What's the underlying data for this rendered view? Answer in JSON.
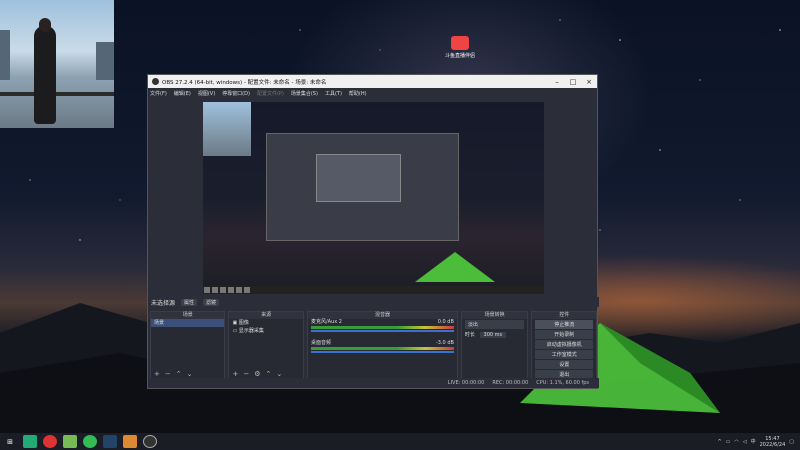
{
  "desktop": {
    "icon_label": "斗鱼直播伴侣"
  },
  "obs": {
    "title": "OBS 27.2.4 (64-bit, windows) - 配置文件: 未命名 - 场景: 未命名",
    "menu": [
      "文件(F)",
      "编辑(E)",
      "视图(V)",
      "停靠窗口(D)",
      "配置文件(P)",
      "场景集合(S)",
      "工具(T)",
      "帮助(H)"
    ],
    "strip": {
      "label": "未选择源",
      "btn1": "属性",
      "btn2": "滤镜"
    },
    "scenes": {
      "header": "场景",
      "items": [
        "场景"
      ]
    },
    "sources": {
      "header": "来源",
      "items": [
        "图像",
        "显示器采集"
      ]
    },
    "mixer": {
      "header": "混音器",
      "ch1": {
        "name": "麦克风/Aux 2",
        "db": "0.0 dB"
      },
      "ch2": {
        "name": "桌面音频",
        "db": "-3.0 dB"
      }
    },
    "transitions": {
      "header": "场景转换",
      "type": "淡出",
      "duration_label": "时长",
      "duration": "300 ms"
    },
    "controls": {
      "header": "控件",
      "buttons": [
        "停止推流",
        "开始录制",
        "启动虚拟摄像机",
        "工作室模式",
        "设置",
        "退出"
      ]
    },
    "status": {
      "live": "LIVE: 00:00:00",
      "rec": "REC: 00:00:00",
      "cpu": "CPU: 1.1%, 60.00 fps"
    }
  },
  "taskbar": {
    "time": "15:47",
    "date": "2022/6/24"
  },
  "colors": {
    "accent": "#4bbd3a",
    "selection": "#3b4f7a"
  }
}
